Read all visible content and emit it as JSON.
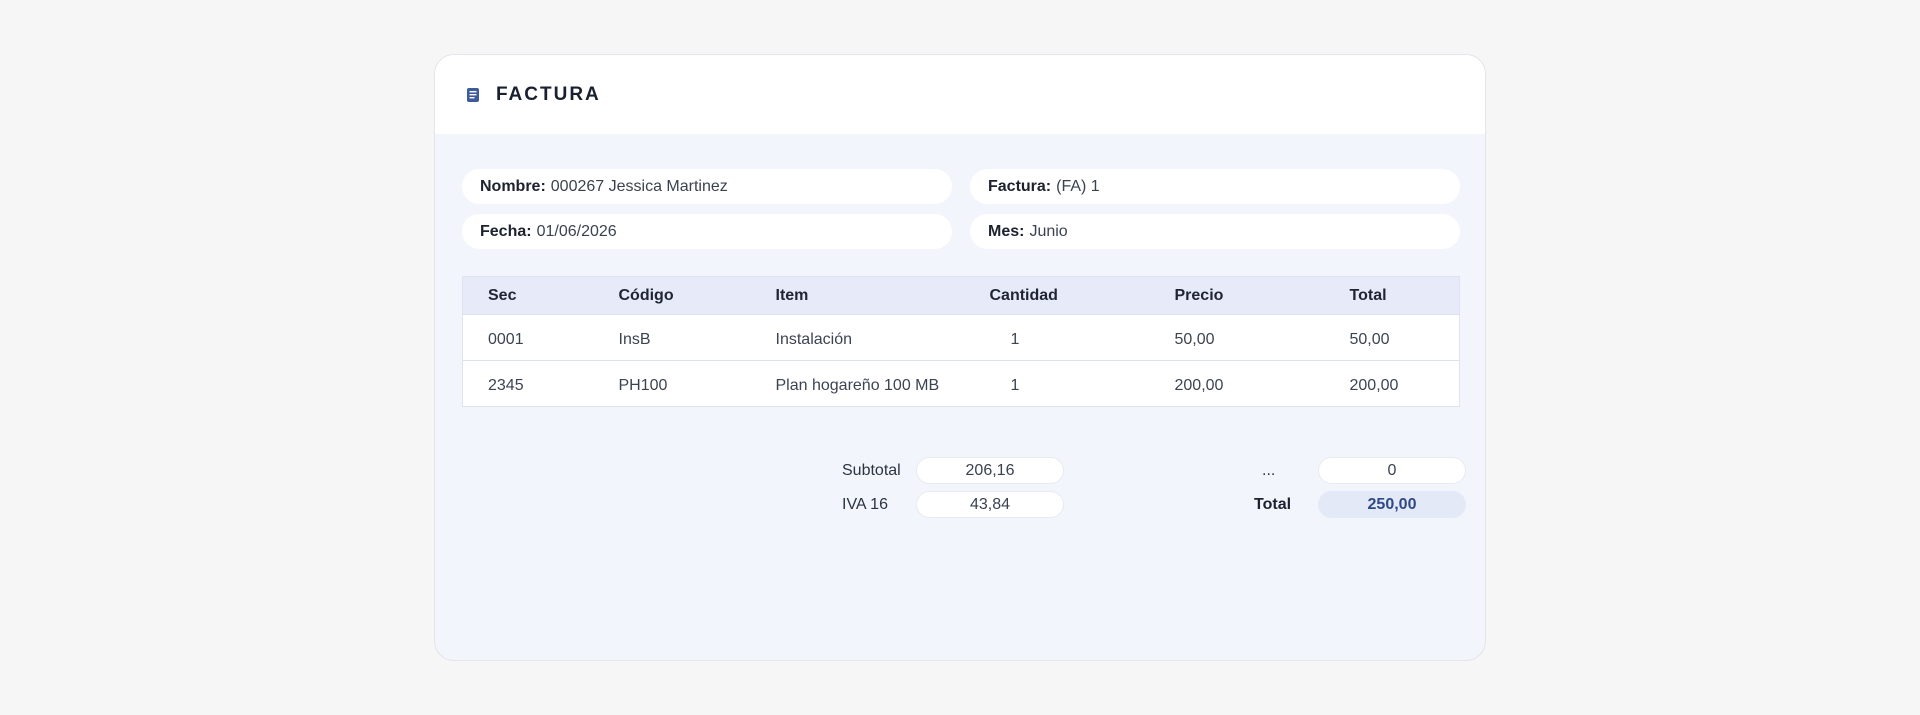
{
  "header": {
    "title": "FACTURA",
    "icon": "document-icon"
  },
  "info": {
    "nombre": {
      "label": "Nombre:",
      "value": "000267 Jessica Martinez"
    },
    "factura": {
      "label": "Factura:",
      "value": "(FA) 1"
    },
    "fecha": {
      "label": "Fecha:",
      "value": "01/06/2026"
    },
    "mes": {
      "label": "Mes:",
      "value": "Junio"
    }
  },
  "table": {
    "columns": [
      "Sec",
      "Código",
      "Item",
      "Cantidad",
      "Precio",
      "Total"
    ],
    "rows": [
      [
        "0001",
        "InsB",
        "Instalación",
        "1",
        "50,00",
        "50,00"
      ],
      [
        "2345",
        "PH100",
        "Plan hogareño 100 MB",
        "1",
        "200,00",
        "200,00"
      ]
    ]
  },
  "totals": {
    "subtotal_label": "Subtotal",
    "subtotal_value": "206,16",
    "iva_label": "IVA 16",
    "iva_value": "43,84",
    "extra_label": "...",
    "extra_value": "0",
    "total_label": "Total",
    "total_value": "250,00"
  },
  "colors": {
    "accent": "#2f4a86",
    "card_bg": "#f2f5fc",
    "table_header_bg": "#e7ebf9"
  }
}
